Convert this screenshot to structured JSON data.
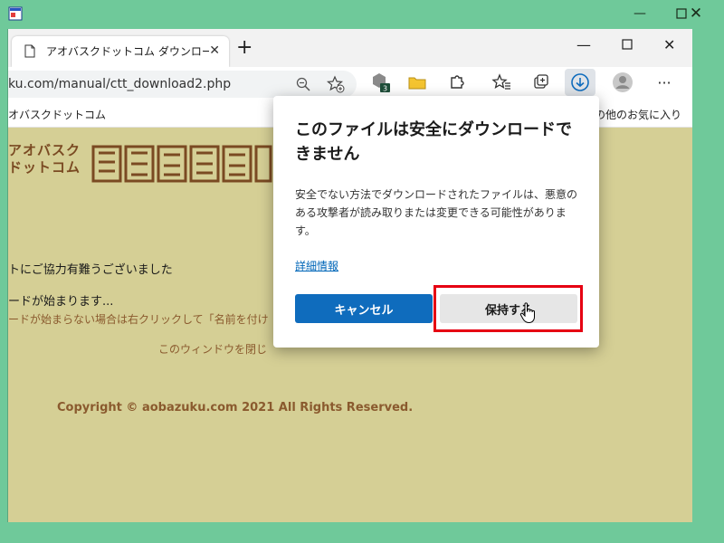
{
  "browser": {
    "tab_title": "アオバスクドットコム ダウンロード有難う",
    "url": "ku.com/manual/ctt_download2.php",
    "download_badge": "3"
  },
  "favorites_bar": {
    "left_item": "オバスクドットコム",
    "right_item": "その他のお気に入り"
  },
  "page": {
    "logo_text": "アオバスク ドットコム",
    "thanks_line": "トにご協力有難うございました",
    "download_start": "ードが始まります...",
    "download_hint": "ードが始まらない場合は右クリックして「名前を付け",
    "close_window": "このウィンドウを閉じ",
    "copyright": "Copyright © aobazuku.com 2021 All Rights Reserved."
  },
  "dialog": {
    "title": "このファイルは安全にダウンロードできません",
    "body": "安全でない方法でダウンロードされたファイルは、悪意のある攻撃者が読み取りまたは変更できる可能性があります。",
    "details_link": "詳細情報",
    "cancel_label": "キャンセル",
    "keep_label": "保持する"
  },
  "colors": {
    "outer_window": "#6fc99a",
    "page_background": "#d5cf95",
    "accent_blue": "#0f6cbd",
    "highlight_red": "#e60012",
    "copyright_text": "#8a5a2e"
  }
}
